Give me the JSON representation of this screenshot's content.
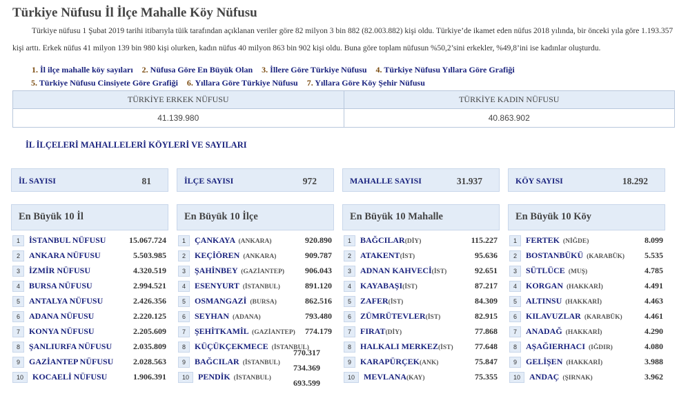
{
  "page": {
    "title": "Türkiye Nüfusu İl İlçe Mahalle Köy Nüfusu",
    "intro_line1": "Türkiye nüfusu 1 Şubat 2019 tarihi itibarıyla tüik tarafından açıklanan veriler göre 82 milyon 3 bin 882 (82.003.882) kişi oldu. Türkiye’de ikamet eden nüfus 2018 yılında, bir önceki yıla göre",
    "intro_line2": "1.193.357 kişi arttı. Erkek nüfus 41 milyon 139 bin 980 kişi olurken, kadın nüfus 40 milyon 863 bin 902 kişi oldu. Buna göre toplam nüfusun %50,2’sini erkekler, %49,8’ini ise kadınlar oluşturdu."
  },
  "links": [
    {
      "num": "1.",
      "label": "İl ilçe mahalle köy sayıları"
    },
    {
      "num": "2.",
      "label": "Nüfusa Göre En Büyük Olan"
    },
    {
      "num": "3.",
      "label": "İllere Göre Türkiye Nüfusu"
    },
    {
      "num": "4.",
      "label": "Türkiye Nüfusu Yıllara Göre Grafiği"
    },
    {
      "num": "5.",
      "label": "Türkiye Nüfusu Cinsiyete Göre Grafiği"
    },
    {
      "num": "6.",
      "label": "Yıllara Göre Türkiye Nüfusu"
    },
    {
      "num": "7.",
      "label": "Yıllara Göre Köy Şehir Nüfusu"
    }
  ],
  "population_table": {
    "male_header": "TÜRKİYE ERKEK NÜFUSU",
    "female_header": "TÜRKİYE KADIN NÜFUSU",
    "male_value": "41.139.980",
    "female_value": "40.863.902"
  },
  "section_title": "İL İLÇELERİ MAHALLELERİ KÖYLERİ VE SAYILARI",
  "counts": [
    {
      "label": "İL SAYISI",
      "value": "81"
    },
    {
      "label": "İLÇE SAYISI",
      "value": "972"
    },
    {
      "label": "MAHALLE SAYISI",
      "value": "31.937"
    },
    {
      "label": "KÖY SAYISI",
      "value": "18.292"
    }
  ],
  "top_il": {
    "title": "En Büyük 10 İl",
    "items": [
      {
        "rank": "1",
        "name": "İSTANBUL NÜFUSU",
        "value": "15.067.724"
      },
      {
        "rank": "2",
        "name": "ANKARA NÜFUSU",
        "value": "5.503.985"
      },
      {
        "rank": "3",
        "name": "İZMİR NÜFUSU",
        "value": "4.320.519"
      },
      {
        "rank": "4",
        "name": "BURSA NÜFUSU",
        "value": "2.994.521"
      },
      {
        "rank": "5",
        "name": "ANTALYA NÜFUSU",
        "value": "2.426.356"
      },
      {
        "rank": "6",
        "name": "ADANA NÜFUSU",
        "value": "2.220.125"
      },
      {
        "rank": "7",
        "name": "KONYA NÜFUSU",
        "value": "2.205.609"
      },
      {
        "rank": "8",
        "name": "ŞANLIURFA NÜFUSU",
        "value": "2.035.809"
      },
      {
        "rank": "9",
        "name": "GAZİANTEP NÜFUSU",
        "value": "2.028.563"
      },
      {
        "rank": "10",
        "name": "KOCAELİ NÜFUSU",
        "value": "1.906.391"
      }
    ]
  },
  "top_ilce": {
    "title": "En Büyük 10 İlçe",
    "items": [
      {
        "rank": "1",
        "name": "ÇANKAYA",
        "sub": "(ANKARA)",
        "value": "920.890"
      },
      {
        "rank": "2",
        "name": "KEÇİÖREN",
        "sub": "(ANKARA)",
        "value": "909.787"
      },
      {
        "rank": "3",
        "name": "ŞAHİNBEY",
        "sub": "(GAZİANTEP)",
        "value": "906.043"
      },
      {
        "rank": "4",
        "name": "ESENYURT",
        "sub": "(İSTANBUL)",
        "value": "891.120"
      },
      {
        "rank": "5",
        "name": "OSMANGAZİ",
        "sub": "(BURSA)",
        "value": "862.516"
      },
      {
        "rank": "6",
        "name": "SEYHAN",
        "sub": "(ADANA)",
        "value": "793.480"
      },
      {
        "rank": "7",
        "name": "ŞEHİTKAMİL",
        "sub": "(GAZİANTEP)",
        "value": "774.179"
      },
      {
        "rank": "8",
        "name": "KÜÇÜKÇEKMECE",
        "sub": "(İSTANBUL)",
        "value": "770.317"
      },
      {
        "rank": "9",
        "name": "BAĞCILAR",
        "sub": "(İSTANBUL)",
        "value": "734.369"
      },
      {
        "rank": "10",
        "name": "PENDİK",
        "sub": "(İSTANBUL)",
        "value": "693.599"
      }
    ]
  },
  "top_mahalle": {
    "title": "En Büyük 10 Mahalle",
    "items": [
      {
        "rank": "1",
        "name": "BAĞCILAR",
        "sub": "(DİY)",
        "value": "115.227"
      },
      {
        "rank": "2",
        "name": "ATAKENT",
        "sub": "(İST)",
        "value": "95.636"
      },
      {
        "rank": "3",
        "name": "ADNAN KAHVECİ",
        "sub": "(İST)",
        "value": "92.651"
      },
      {
        "rank": "4",
        "name": "KAYABAŞI",
        "sub": "(İST)",
        "value": "87.217"
      },
      {
        "rank": "5",
        "name": "ZAFER",
        "sub": "(İST)",
        "value": "84.309"
      },
      {
        "rank": "6",
        "name": "ZÜMRÜTEVLER",
        "sub": "(İST)",
        "value": "82.915"
      },
      {
        "rank": "7",
        "name": "FIRAT",
        "sub": "(DİY)",
        "value": "77.868"
      },
      {
        "rank": "8",
        "name": "HALKALI MERKEZ",
        "sub": "(İST)",
        "value": "77.648"
      },
      {
        "rank": "9",
        "name": "KARAPÜRÇEK",
        "sub": "(ANK)",
        "value": "75.847"
      },
      {
        "rank": "10",
        "name": "MEVLANA",
        "sub": "(KAY)",
        "value": "75.355"
      }
    ]
  },
  "top_koy": {
    "title": "En Büyük 10 Köy",
    "items": [
      {
        "rank": "1",
        "name": "FERTEK",
        "sub": "(NİĞDE)",
        "value": "8.099"
      },
      {
        "rank": "2",
        "name": "BOSTANBÜKÜ",
        "sub": "(KARABÜK)",
        "value": "5.535"
      },
      {
        "rank": "3",
        "name": "SÜTLÜCE",
        "sub": "(MUŞ)",
        "value": "4.785"
      },
      {
        "rank": "4",
        "name": "KORGAN",
        "sub": "(HAKKARİ)",
        "value": "4.491"
      },
      {
        "rank": "5",
        "name": "ALTINSU",
        "sub": "(HAKKARİ)",
        "value": "4.463"
      },
      {
        "rank": "6",
        "name": "KILAVUZLAR",
        "sub": "(KARABÜK)",
        "value": "4.461"
      },
      {
        "rank": "7",
        "name": "ANADAĞ",
        "sub": "(HAKKARİ)",
        "value": "4.290"
      },
      {
        "rank": "8",
        "name": "AŞAĞIERHACI",
        "sub": "(IĞDIR)",
        "value": "4.080"
      },
      {
        "rank": "9",
        "name": "GELİŞEN",
        "sub": "(HAKKARİ)",
        "value": "3.988"
      },
      {
        "rank": "10",
        "name": "ANDAÇ",
        "sub": "(ŞIRNAK)",
        "value": "3.962"
      }
    ]
  }
}
